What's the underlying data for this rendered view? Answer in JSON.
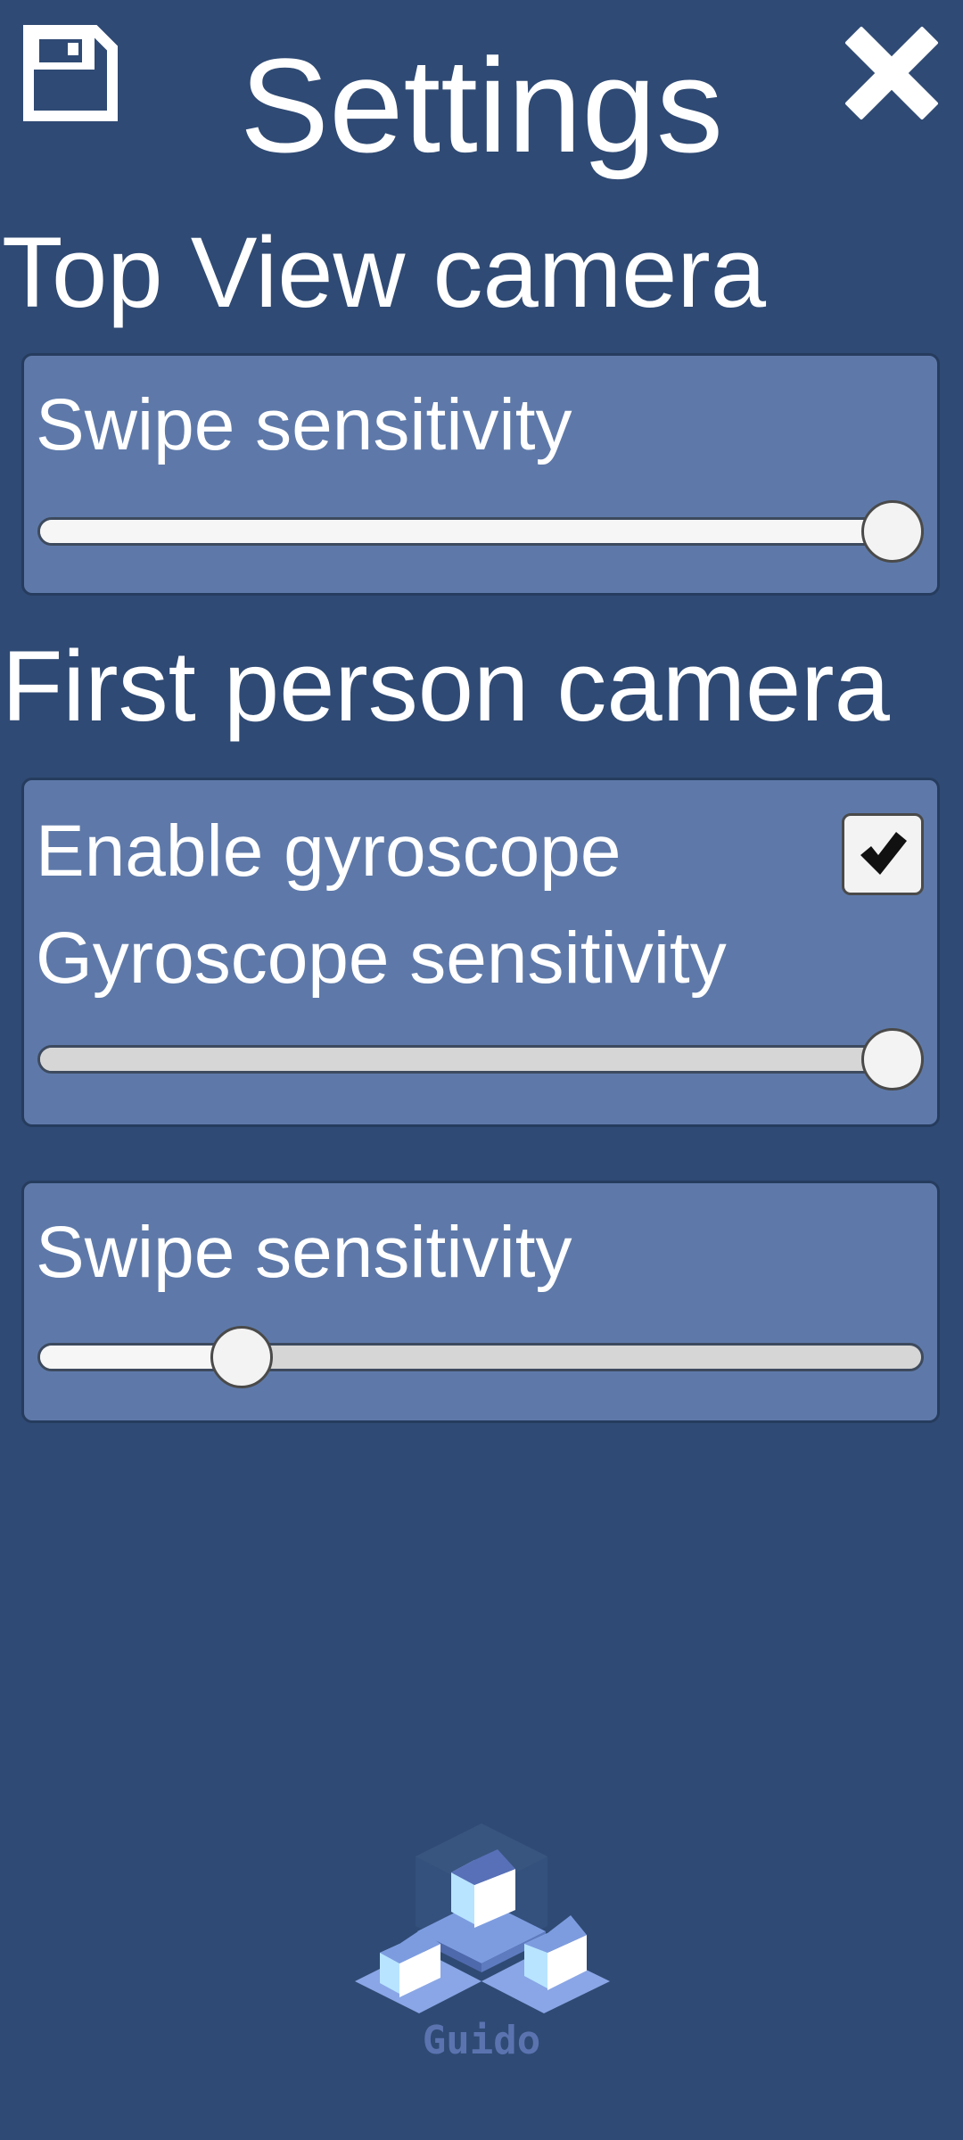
{
  "header": {
    "title": "Settings",
    "save_icon": "floppy-disk-icon",
    "close_icon": "close-icon"
  },
  "top_view": {
    "title": "Top View camera",
    "swipe_sensitivity": {
      "label": "Swipe sensitivity",
      "value": 1.0
    }
  },
  "first_person": {
    "title": "First person camera",
    "gyroscope": {
      "enable_label": "Enable gyroscope",
      "enabled": true,
      "sensitivity_label": "Gyroscope sensitivity",
      "sensitivity_value": 1.0
    },
    "swipe_sensitivity": {
      "label": "Swipe sensitivity",
      "value": 0.21
    }
  },
  "logo": {
    "text": "Guido"
  },
  "colors": {
    "background": "#2f4a74",
    "panel": "#5e79a9",
    "logo_text": "#5b74b0"
  }
}
